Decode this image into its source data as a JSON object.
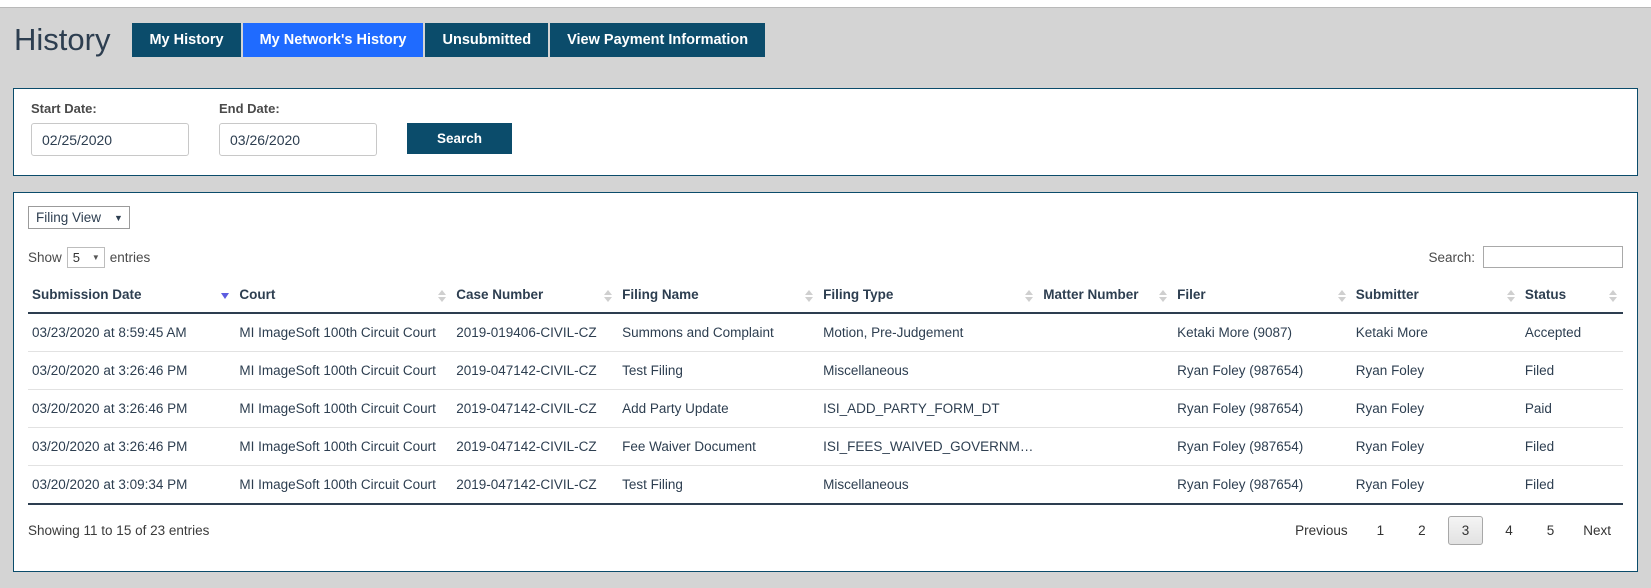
{
  "header": {
    "title": "History",
    "tabs": [
      {
        "label": "My History",
        "active": false
      },
      {
        "label": "My Network's History",
        "active": true
      },
      {
        "label": "Unsubmitted",
        "active": false
      },
      {
        "label": "View Payment Information",
        "active": false
      }
    ]
  },
  "search_panel": {
    "start_date_label": "Start Date:",
    "start_date_value": "02/25/2020",
    "end_date_label": "End Date:",
    "end_date_value": "03/26/2020",
    "search_button": "Search"
  },
  "table_panel": {
    "view_select": {
      "value": "Filing View",
      "caret": "▼"
    },
    "show_prefix": "Show",
    "show_value": "5",
    "show_suffix": "entries",
    "search_label": "Search:",
    "search_value": "",
    "search_placeholder": "",
    "columns": [
      {
        "label": "Submission Date",
        "sort": "desc"
      },
      {
        "label": "Court",
        "sort": "none"
      },
      {
        "label": "Case Number",
        "sort": "none"
      },
      {
        "label": "Filing Name",
        "sort": "none"
      },
      {
        "label": "Filing Type",
        "sort": "none"
      },
      {
        "label": "Matter Number",
        "sort": "none"
      },
      {
        "label": "Filer",
        "sort": "none"
      },
      {
        "label": "Submitter",
        "sort": "none"
      },
      {
        "label": "Status",
        "sort": "none"
      }
    ],
    "rows": [
      {
        "submission_date": "03/23/2020 at 8:59:45 AM",
        "court": "MI ImageSoft 100th Circuit Court",
        "case_number": "2019-019406-CIVIL-CZ",
        "filing_name": "Summons and Complaint",
        "filing_type": "Motion, Pre-Judgement",
        "matter_number": "",
        "filer": "Ketaki More (9087)",
        "submitter": "Ketaki More",
        "status": "Accepted"
      },
      {
        "submission_date": "03/20/2020 at 3:26:46 PM",
        "court": "MI ImageSoft 100th Circuit Court",
        "case_number": "2019-047142-CIVIL-CZ",
        "filing_name": "Test Filing",
        "filing_type": "Miscellaneous",
        "matter_number": "",
        "filer": "Ryan Foley (987654)",
        "submitter": "Ryan Foley",
        "status": "Filed"
      },
      {
        "submission_date": "03/20/2020 at 3:26:46 PM",
        "court": "MI ImageSoft 100th Circuit Court",
        "case_number": "2019-047142-CIVIL-CZ",
        "filing_name": "Add Party Update",
        "filing_type": "ISI_ADD_PARTY_FORM_DT",
        "matter_number": "",
        "filer": "Ryan Foley (987654)",
        "submitter": "Ryan Foley",
        "status": "Paid"
      },
      {
        "submission_date": "03/20/2020 at 3:26:46 PM",
        "court": "MI ImageSoft 100th Circuit Court",
        "case_number": "2019-047142-CIVIL-CZ",
        "filing_name": "Fee Waiver Document",
        "filing_type": "ISI_FEES_WAIVED_GOVERNMEN…",
        "matter_number": "",
        "filer": "Ryan Foley (987654)",
        "submitter": "Ryan Foley",
        "status": "Filed"
      },
      {
        "submission_date": "03/20/2020 at 3:09:34 PM",
        "court": "MI ImageSoft 100th Circuit Court",
        "case_number": "2019-047142-CIVIL-CZ",
        "filing_name": "Test Filing",
        "filing_type": "Miscellaneous",
        "matter_number": "",
        "filer": "Ryan Foley (987654)",
        "submitter": "Ryan Foley",
        "status": "Filed"
      }
    ],
    "showing_info": "Showing 11 to 15 of 23 entries",
    "pagination": [
      {
        "label": "Previous",
        "active": false,
        "word": true
      },
      {
        "label": "1",
        "active": false,
        "word": false
      },
      {
        "label": "2",
        "active": false,
        "word": false
      },
      {
        "label": "3",
        "active": true,
        "word": false
      },
      {
        "label": "4",
        "active": false,
        "word": false
      },
      {
        "label": "5",
        "active": false,
        "word": false
      },
      {
        "label": "Next",
        "active": false,
        "word": true
      }
    ]
  },
  "colors": {
    "brand_dark": "#0b4c6b",
    "accent_blue": "#1f6bff",
    "text_navy": "#2d3e50",
    "page_bg": "#d4d4d4"
  }
}
